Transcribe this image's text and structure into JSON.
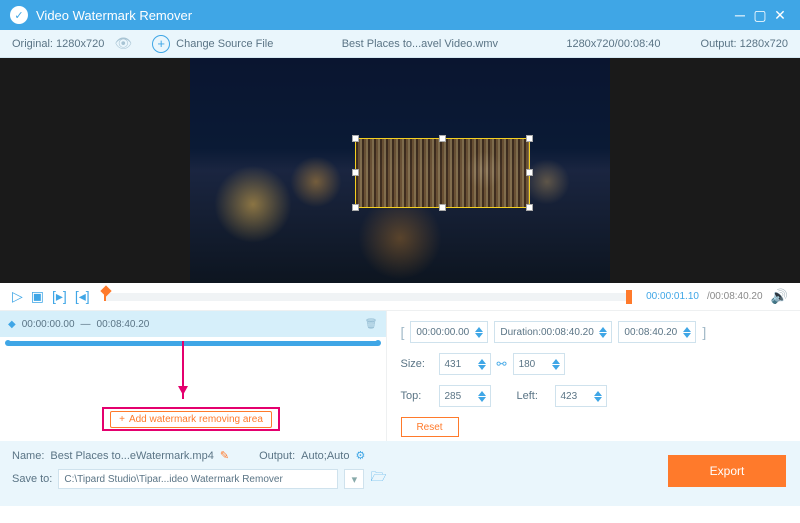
{
  "titlebar": {
    "title": "Video Watermark Remover"
  },
  "infobar": {
    "original_label": "Original:",
    "original_dims": "1280x720",
    "change_label": "Change Source File",
    "filename": "Best Places to...avel Video.wmv",
    "dims_duration": "1280x720/00:08:40",
    "output_label": "Output:",
    "output_dims": "1280x720"
  },
  "playback": {
    "current": "00:00:01.10",
    "total": "/00:08:40.20"
  },
  "segment": {
    "start": "00:00:00.00",
    "sep": "—",
    "end": "00:08:40.20"
  },
  "add_btn": "Add watermark removing area",
  "fields": {
    "range_start": "00:00:00.00",
    "duration_label": "Duration:",
    "duration": "00:08:40.20",
    "range_end": "00:08:40.20",
    "size_label": "Size:",
    "size_w": "431",
    "size_h": "180",
    "top_label": "Top:",
    "top": "285",
    "left_label": "Left:",
    "left": "423",
    "reset": "Reset"
  },
  "bottom": {
    "name_label": "Name:",
    "name_value": "Best Places to...eWatermark.mp4",
    "output_label": "Output:",
    "output_value": "Auto;Auto",
    "save_label": "Save to:",
    "save_path": "C:\\Tipard Studio\\Tipar...ideo Watermark Remover",
    "export": "Export"
  }
}
